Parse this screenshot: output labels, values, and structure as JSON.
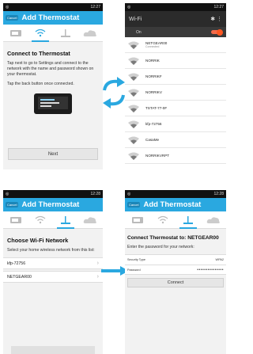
{
  "shared": {
    "status_time": "12:27",
    "status_time_2": "12:28",
    "cancel": "Cancel",
    "app_title": "Add Thermostat",
    "accent": "#2aa8e0"
  },
  "panel1": {
    "heading": "Connect to Thermostat",
    "para1": "Tap next to go to Settings and connect to the network with the name and password shown on your thermostat.",
    "para2": "Tap the back button once connected.",
    "next": "Next"
  },
  "panel2": {
    "title": "Wi-Fi",
    "on_label": "On",
    "networks": [
      {
        "name": "NETGEAR00",
        "sub": "Connected"
      },
      {
        "name": "NORRIK",
        "sub": ""
      },
      {
        "name": "NORRIKF",
        "sub": ""
      },
      {
        "name": "NORRIKV",
        "sub": ""
      },
      {
        "name": "TSTAT-77-0F",
        "sub": ""
      },
      {
        "name": "kfp-72756",
        "sub": ""
      },
      {
        "name": "CasaMe",
        "sub": ""
      },
      {
        "name": "NORRIKVRPT",
        "sub": ""
      }
    ]
  },
  "panel3": {
    "heading": "Choose Wi-Fi Network",
    "para": "Select your home wireless network from this list:",
    "networks": [
      "kfp-72756",
      "NETGEAR00"
    ]
  },
  "panel4": {
    "heading": "Connect Thermostat to: NETGEAR00",
    "para": "Enter the password for your network:",
    "security_label": "Security Type",
    "security_value": "WPA2",
    "password_label": "Password",
    "password_value": "•••••••••••••••",
    "connect": "Connect"
  }
}
